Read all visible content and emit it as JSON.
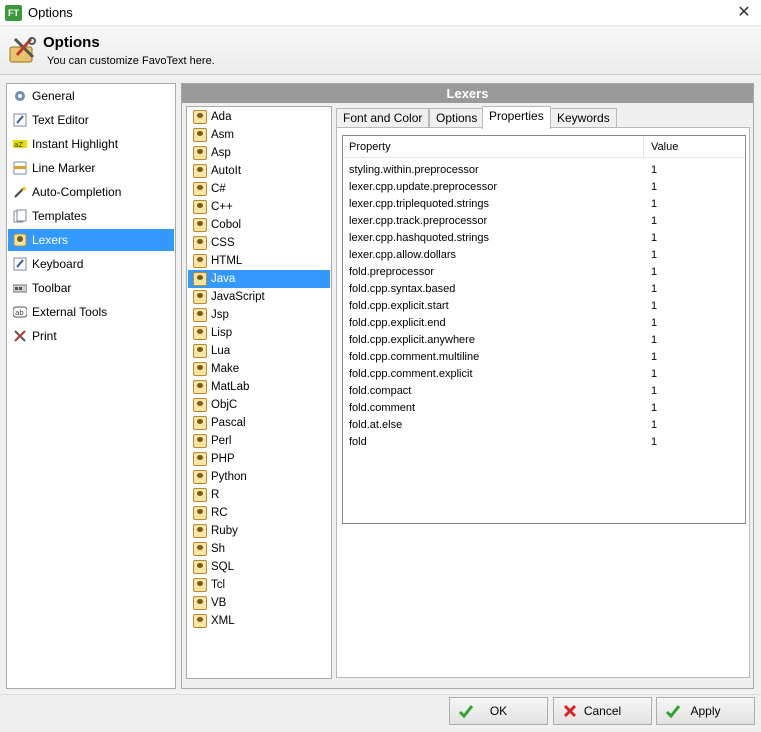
{
  "window": {
    "app_icon": "FT",
    "title": "Options",
    "close_glyph": "✕"
  },
  "header": {
    "title": "Options",
    "subtitle": "You can customize FavoText here."
  },
  "nav": {
    "items": [
      {
        "label": "General",
        "icon": "gear-icon"
      },
      {
        "label": "Text Editor",
        "icon": "pen-icon"
      },
      {
        "label": "Instant Highlight",
        "icon": "highlight-icon"
      },
      {
        "label": "Line Marker",
        "icon": "line-marker-icon"
      },
      {
        "label": "Auto-Completion",
        "icon": "wand-icon"
      },
      {
        "label": "Templates",
        "icon": "templates-icon"
      },
      {
        "label": "Lexers",
        "icon": "lexers-icon"
      },
      {
        "label": "Keyboard",
        "icon": "keyboard-icon"
      },
      {
        "label": "Toolbar",
        "icon": "toolbar-icon"
      },
      {
        "label": "External Tools",
        "icon": "external-tools-icon"
      },
      {
        "label": "Print",
        "icon": "tools-icon"
      }
    ],
    "selected": "Lexers"
  },
  "lexers": {
    "heading": "Lexers",
    "items": [
      "Ada",
      "Asm",
      "Asp",
      "AutoIt",
      "C#",
      "C++",
      "Cobol",
      "CSS",
      "HTML",
      "Java",
      "JavaScript",
      "Jsp",
      "Lisp",
      "Lua",
      "Make",
      "MatLab",
      "ObjC",
      "Pascal",
      "Perl",
      "PHP",
      "Python",
      "R",
      "RC",
      "Ruby",
      "Sh",
      "SQL",
      "Tcl",
      "VB",
      "XML"
    ],
    "selected": "Java"
  },
  "tabs": {
    "items": [
      "Font and Color",
      "Options",
      "Properties",
      "Keywords"
    ],
    "active": "Properties"
  },
  "properties": {
    "columns": {
      "property": "Property",
      "value": "Value"
    },
    "rows": [
      {
        "name": "styling.within.preprocessor",
        "value": "1"
      },
      {
        "name": "lexer.cpp.update.preprocessor",
        "value": "1"
      },
      {
        "name": "lexer.cpp.triplequoted.strings",
        "value": "1"
      },
      {
        "name": "lexer.cpp.track.preprocessor",
        "value": "1"
      },
      {
        "name": "lexer.cpp.hashquoted.strings",
        "value": "1"
      },
      {
        "name": "lexer.cpp.allow.dollars",
        "value": "1"
      },
      {
        "name": "fold.preprocessor",
        "value": "1"
      },
      {
        "name": "fold.cpp.syntax.based",
        "value": "1"
      },
      {
        "name": "fold.cpp.explicit.start",
        "value": "1"
      },
      {
        "name": "fold.cpp.explicit.end",
        "value": "1"
      },
      {
        "name": "fold.cpp.explicit.anywhere",
        "value": "1"
      },
      {
        "name": "fold.cpp.comment.multiline",
        "value": "1"
      },
      {
        "name": "fold.cpp.comment.explicit",
        "value": "1"
      },
      {
        "name": "fold.compact",
        "value": "1"
      },
      {
        "name": "fold.comment",
        "value": "1"
      },
      {
        "name": "fold.at.else",
        "value": "1"
      },
      {
        "name": "fold",
        "value": "1"
      }
    ]
  },
  "buttons": {
    "ok": {
      "label": "OK",
      "icon": "check-icon"
    },
    "cancel": {
      "label": "Cancel",
      "icon": "cross-icon"
    },
    "apply": {
      "label": "Apply",
      "icon": "check-icon"
    }
  },
  "colors": {
    "selection": "#3399ff",
    "ok_green": "#2ea52e",
    "cancel_red": "#d62424",
    "lexers_header": "#9a9a9a"
  }
}
